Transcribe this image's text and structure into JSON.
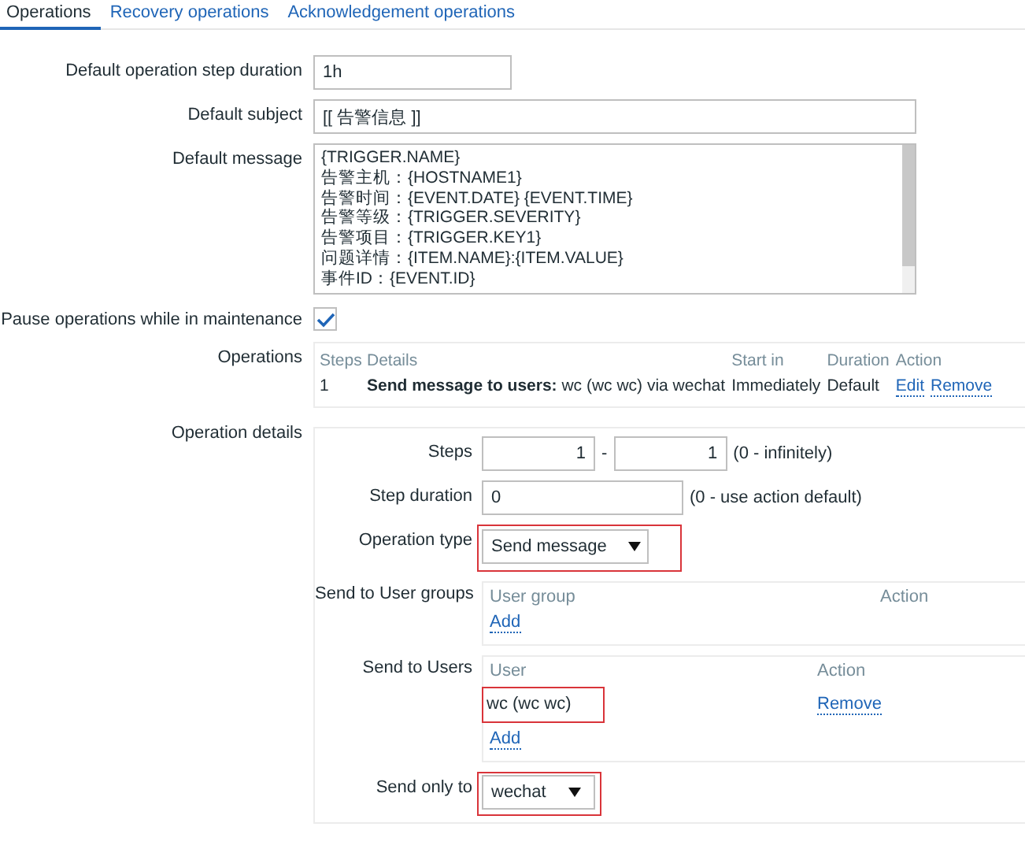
{
  "tabs": [
    {
      "label": "Operations",
      "selected": true
    },
    {
      "label": "Recovery operations",
      "selected": false
    },
    {
      "label": "Acknowledgement operations",
      "selected": false
    }
  ],
  "step_duration": {
    "label": "Default operation step duration",
    "value": "1h"
  },
  "subject": {
    "label": "Default subject",
    "value": "[[ 告警信息 ]]"
  },
  "message": {
    "label": "Default message",
    "lines": [
      "{TRIGGER.NAME}",
      "告警主机：{HOSTNAME1}",
      "告警时间：{EVENT.DATE} {EVENT.TIME}",
      "告警等级：{TRIGGER.SEVERITY}",
      "告警项目：{TRIGGER.KEY1}",
      "问题详情：{ITEM.NAME}:{ITEM.VALUE}",
      "事件ID：{EVENT.ID}"
    ]
  },
  "pause": {
    "label": "Pause operations while in maintenance",
    "checked": true
  },
  "operations": {
    "label": "Operations",
    "columns": [
      "Steps",
      "Details",
      "Start in",
      "Duration",
      "Action"
    ],
    "rows": [
      {
        "steps": "1",
        "details": "**Send message to users:** wc (wc wc) via wechat",
        "start_in": "Immediately",
        "duration": "Default",
        "actions": [
          "Edit",
          "Remove"
        ]
      }
    ]
  },
  "details": {
    "label": "Operation details",
    "steps": {
      "label": "Steps",
      "from": "1",
      "separator": "-",
      "to": "1",
      "hint": "(0 - infinitely)"
    },
    "step_duration": {
      "label": "Step duration",
      "value": "0",
      "hint": "(0 - use action default)"
    },
    "operation_type": {
      "label": "Operation type",
      "value": "Send message",
      "highlighted": true
    },
    "user_groups": {
      "label": "Send to User groups",
      "columns": [
        "User group",
        "Action"
      ],
      "add": "Add"
    },
    "users": {
      "label": "Send to Users",
      "columns": [
        "User",
        "Action"
      ],
      "rows": [
        {
          "name": "wc (wc wc)",
          "action": "Remove",
          "highlighted": true
        }
      ],
      "add": "Add"
    },
    "send_only_to": {
      "label": "Send only to",
      "value": "wechat",
      "highlighted": true
    }
  }
}
